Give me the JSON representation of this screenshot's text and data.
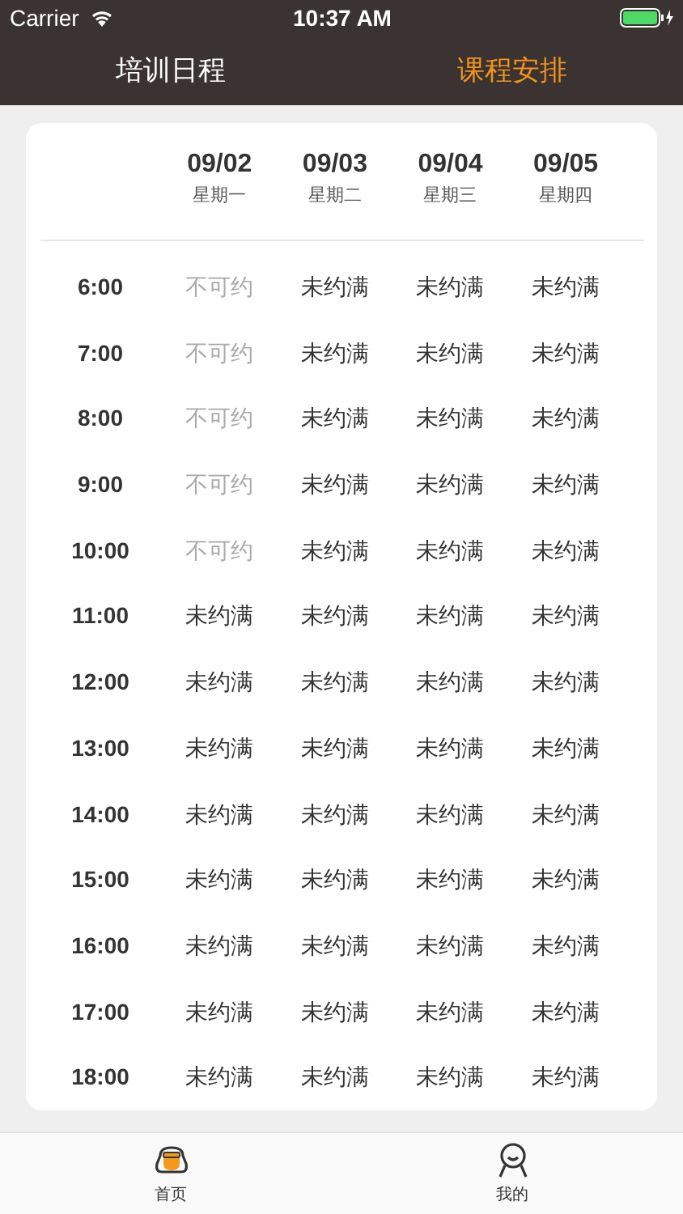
{
  "status_bar": {
    "carrier": "Carrier",
    "time": "10:37 AM"
  },
  "tabs": [
    {
      "label": "培训日程",
      "selected": false
    },
    {
      "label": "课程安排",
      "selected": true
    }
  ],
  "schedule": {
    "columns": [
      {
        "date": "09/02",
        "weekday": "星期一"
      },
      {
        "date": "09/03",
        "weekday": "星期二"
      },
      {
        "date": "09/04",
        "weekday": "星期三"
      },
      {
        "date": "09/05",
        "weekday": "星期四"
      }
    ],
    "rows": [
      {
        "time": "6:00",
        "cells": [
          {
            "text": "不可约",
            "disabled": true
          },
          {
            "text": "未约满",
            "disabled": false
          },
          {
            "text": "未约满",
            "disabled": false
          },
          {
            "text": "未约满",
            "disabled": false
          }
        ]
      },
      {
        "time": "7:00",
        "cells": [
          {
            "text": "不可约",
            "disabled": true
          },
          {
            "text": "未约满",
            "disabled": false
          },
          {
            "text": "未约满",
            "disabled": false
          },
          {
            "text": "未约满",
            "disabled": false
          }
        ]
      },
      {
        "time": "8:00",
        "cells": [
          {
            "text": "不可约",
            "disabled": true
          },
          {
            "text": "未约满",
            "disabled": false
          },
          {
            "text": "未约满",
            "disabled": false
          },
          {
            "text": "未约满",
            "disabled": false
          }
        ]
      },
      {
        "time": "9:00",
        "cells": [
          {
            "text": "不可约",
            "disabled": true
          },
          {
            "text": "未约满",
            "disabled": false
          },
          {
            "text": "未约满",
            "disabled": false
          },
          {
            "text": "未约满",
            "disabled": false
          }
        ]
      },
      {
        "time": "10:00",
        "cells": [
          {
            "text": "不可约",
            "disabled": true
          },
          {
            "text": "未约满",
            "disabled": false
          },
          {
            "text": "未约满",
            "disabled": false
          },
          {
            "text": "未约满",
            "disabled": false
          }
        ]
      },
      {
        "time": "11:00",
        "cells": [
          {
            "text": "未约满",
            "disabled": false
          },
          {
            "text": "未约满",
            "disabled": false
          },
          {
            "text": "未约满",
            "disabled": false
          },
          {
            "text": "未约满",
            "disabled": false
          }
        ]
      },
      {
        "time": "12:00",
        "cells": [
          {
            "text": "未约满",
            "disabled": false
          },
          {
            "text": "未约满",
            "disabled": false
          },
          {
            "text": "未约满",
            "disabled": false
          },
          {
            "text": "未约满",
            "disabled": false
          }
        ]
      },
      {
        "time": "13:00",
        "cells": [
          {
            "text": "未约满",
            "disabled": false
          },
          {
            "text": "未约满",
            "disabled": false
          },
          {
            "text": "未约满",
            "disabled": false
          },
          {
            "text": "未约满",
            "disabled": false
          }
        ]
      },
      {
        "time": "14:00",
        "cells": [
          {
            "text": "未约满",
            "disabled": false
          },
          {
            "text": "未约满",
            "disabled": false
          },
          {
            "text": "未约满",
            "disabled": false
          },
          {
            "text": "未约满",
            "disabled": false
          }
        ]
      },
      {
        "time": "15:00",
        "cells": [
          {
            "text": "未约满",
            "disabled": false
          },
          {
            "text": "未约满",
            "disabled": false
          },
          {
            "text": "未约满",
            "disabled": false
          },
          {
            "text": "未约满",
            "disabled": false
          }
        ]
      },
      {
        "time": "16:00",
        "cells": [
          {
            "text": "未约满",
            "disabled": false
          },
          {
            "text": "未约满",
            "disabled": false
          },
          {
            "text": "未约满",
            "disabled": false
          },
          {
            "text": "未约满",
            "disabled": false
          }
        ]
      },
      {
        "time": "17:00",
        "cells": [
          {
            "text": "未约满",
            "disabled": false
          },
          {
            "text": "未约满",
            "disabled": false
          },
          {
            "text": "未约满",
            "disabled": false
          },
          {
            "text": "未约满",
            "disabled": false
          }
        ]
      },
      {
        "time": "18:00",
        "cells": [
          {
            "text": "未约满",
            "disabled": false
          },
          {
            "text": "未约满",
            "disabled": false
          },
          {
            "text": "未约满",
            "disabled": false
          },
          {
            "text": "未约满",
            "disabled": false
          }
        ]
      }
    ]
  },
  "tab_bar": [
    {
      "label": "首页",
      "selected": true,
      "kind": "home"
    },
    {
      "label": "我的",
      "selected": false,
      "kind": "profile"
    }
  ]
}
